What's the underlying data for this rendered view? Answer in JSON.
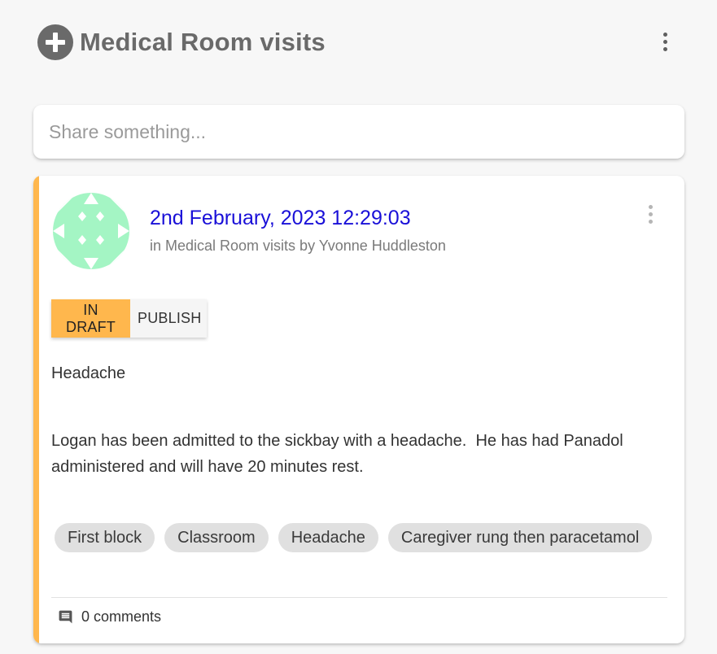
{
  "header": {
    "title": "Medical Room visits",
    "add_icon": "plus-circle-icon",
    "menu_icon": "more-vertical-icon"
  },
  "share": {
    "placeholder": "Share something..."
  },
  "post": {
    "date": "2nd February, 2023 12:29:03",
    "meta": "in Medical Room visits by Yvonne Huddleston",
    "status": {
      "draft_label": "IN DRAFT",
      "publish_label": "PUBLISH",
      "active": "IN DRAFT"
    },
    "heading": "Headache",
    "body": "Logan has been admitted to the sickbay with a headache.  He has had Panadol administered and will have 20 minutes rest.",
    "tags": [
      "First block",
      "Classroom",
      "Headache",
      "Caregiver rung then paracetamol"
    ],
    "comments_label": "0 comments",
    "comments_icon": "comment-icon",
    "menu_icon": "more-vertical-icon"
  },
  "colors": {
    "accent": "#ffb74d",
    "date_link": "#1a10d8",
    "avatar": "#a4f5c4",
    "header_text": "#6a6a6a"
  }
}
